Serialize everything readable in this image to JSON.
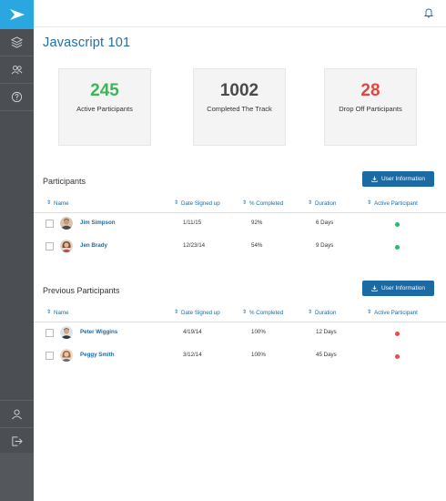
{
  "page": {
    "title": "Javascript 101"
  },
  "stats": [
    {
      "value": "245",
      "label": "Active Participants",
      "color": "#3fb55a"
    },
    {
      "value": "1002",
      "label": "Completed The Track",
      "color": "#4a4a4a"
    },
    {
      "value": "28",
      "label": "Drop Off Participants",
      "color": "#e2463e"
    }
  ],
  "columns": [
    "Name",
    "Date Signed up",
    "% Completed",
    "Duration",
    "Active Participant"
  ],
  "participants": {
    "title": "Participants",
    "button": "User Information",
    "rows": [
      {
        "name": "Jim Simpson",
        "date": "1/11/15",
        "completed": "92%",
        "duration": "6 Days",
        "active": true
      },
      {
        "name": "Jen Brady",
        "date": "12/23/14",
        "completed": "54%",
        "duration": "9 Days",
        "active": true
      }
    ]
  },
  "previous": {
    "title": "Previous Participants",
    "button": "User Information",
    "rows": [
      {
        "name": "Peter Wiggins",
        "date": "4/19/14",
        "completed": "100%",
        "duration": "12 Days",
        "active": false
      },
      {
        "name": "Peggy Smith",
        "date": "3/12/14",
        "completed": "100%",
        "duration": "45 Days",
        "active": false
      }
    ]
  },
  "colors": {
    "active": "#2ab869",
    "inactive": "#e84b4b",
    "accent": "#1c6aa3",
    "brand": "#2aa7e0"
  }
}
